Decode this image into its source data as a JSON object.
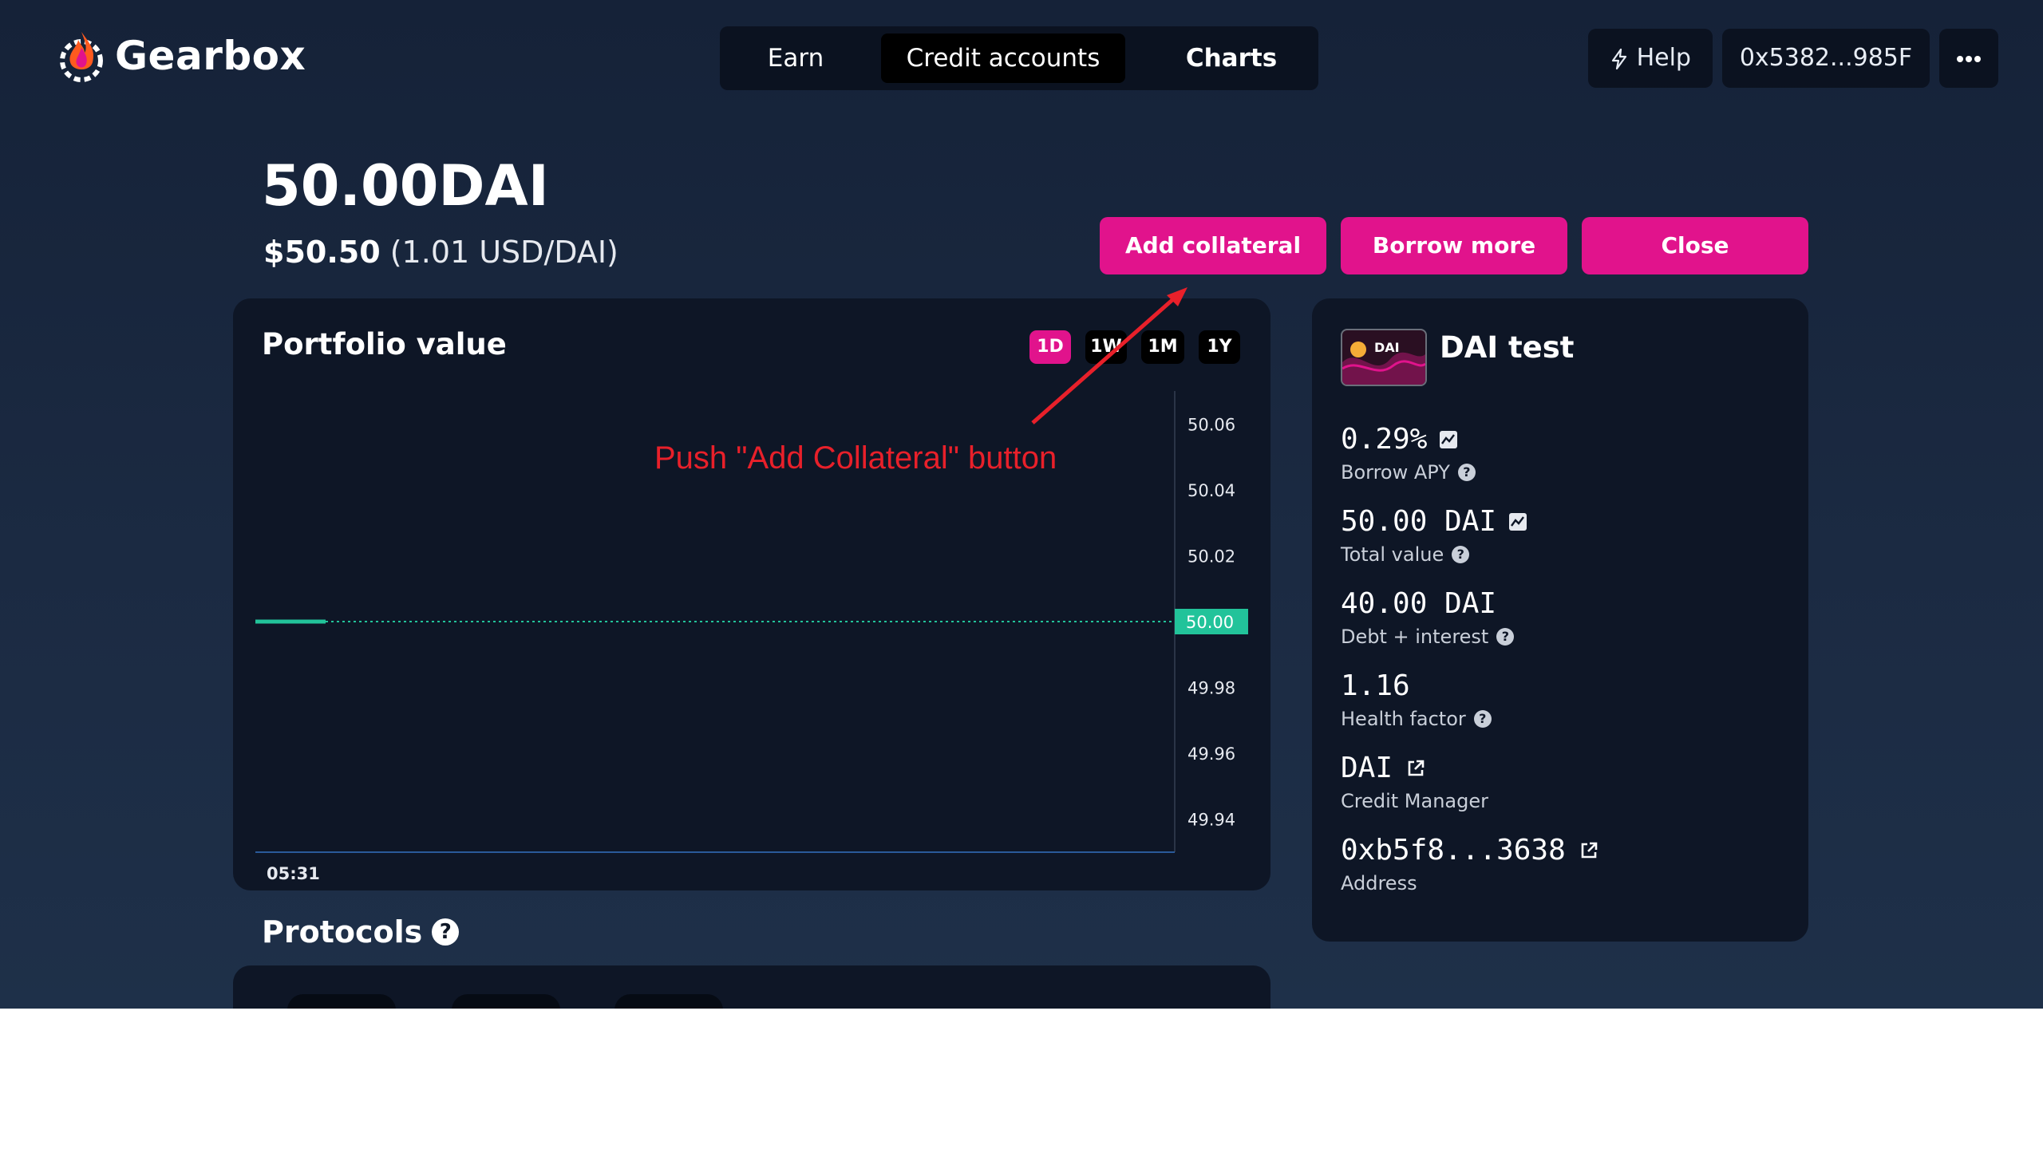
{
  "brand": {
    "name": "Gearbox"
  },
  "nav": {
    "tabs": [
      {
        "label": "Earn"
      },
      {
        "label": "Credit accounts"
      },
      {
        "label": "Charts"
      }
    ]
  },
  "header": {
    "help_label": "Help",
    "wallet_address": "0x5382...985F",
    "more_icon": "more-icon"
  },
  "account": {
    "amount": "50.00DAI",
    "usd_value": "$50.50",
    "rate": "(1.01 USD/DAI)"
  },
  "actions": {
    "add_collateral": "Add collateral",
    "borrow_more": "Borrow more",
    "close": "Close"
  },
  "portfolio": {
    "title": "Portfolio value",
    "ranges": [
      "1D",
      "1W",
      "1M",
      "1Y"
    ],
    "active_range": "1D",
    "chart_data": {
      "type": "line",
      "x": [
        "05:31"
      ],
      "series": [
        {
          "values": [
            50.0
          ]
        }
      ],
      "ylim": [
        49.93,
        50.07
      ],
      "yticks": [
        50.06,
        50.04,
        50.02,
        50.0,
        49.98,
        49.96,
        49.94
      ],
      "ytick_labels": [
        "50.06",
        "50.04",
        "50.02",
        "50.00",
        "49.98",
        "49.96",
        "49.94"
      ],
      "current_value_label": "50.00",
      "xtick_labels": [
        "05:31"
      ],
      "line_color": "#22c39a"
    }
  },
  "annotation": {
    "text": "Push \"Add Collateral\" button",
    "color": "#e8202a"
  },
  "account_info": {
    "badge_label": "DAI",
    "title": "DAI test",
    "stats": [
      {
        "value": "0.29%",
        "label": "Borrow APY"
      },
      {
        "value": "50.00 DAI",
        "label": "Total value"
      },
      {
        "value": "40.00 DAI",
        "label": "Debt + interest"
      },
      {
        "value": "1.16",
        "label": "Health factor"
      },
      {
        "value": "DAI",
        "label": "Credit Manager"
      },
      {
        "value": "0xb5f8...3638",
        "label": "Address"
      }
    ]
  },
  "protocols": {
    "title": "Protocols"
  },
  "colors": {
    "accent": "#e1138c",
    "background": "#1b2a42",
    "card": "#0e1626",
    "chart_line": "#22c39a"
  }
}
